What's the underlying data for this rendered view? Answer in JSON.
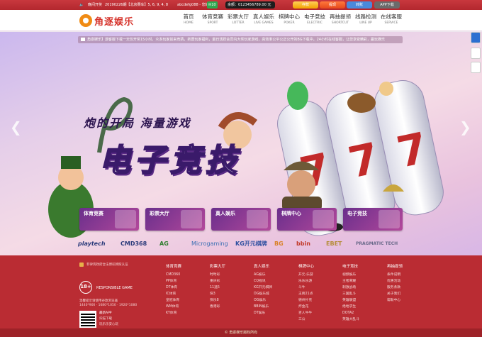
{
  "topbar": {
    "greeting": "晚间开奖",
    "notice": "20190226期【北京赛车】5, 6, 9, 4, 8",
    "username": "abcdefg088 - 您好",
    "mail_count": "10",
    "balance": "余额：0123456789.00 元",
    "deposit": "存款",
    "withdraw": "提现",
    "transfer": "转账",
    "app": "APP下载"
  },
  "nav": {
    "logo": "角逐娱乐",
    "items": [
      {
        "cn": "首页",
        "en": "HOME"
      },
      {
        "cn": "体育竞赛",
        "en": "SPORT"
      },
      {
        "cn": "彩票大厅",
        "en": "LOTTER"
      },
      {
        "cn": "真人娱乐",
        "en": "LIVE GAMES"
      },
      {
        "cn": "棋牌中心",
        "en": "POKER"
      },
      {
        "cn": "电子竞技",
        "en": "ELECTRIC"
      },
      {
        "cn": "再抽提领",
        "en": "SHORTCUT"
      },
      {
        "cn": "线路检测",
        "en": "LINE UP"
      },
      {
        "cn": "在线客服",
        "en": "SERVICE"
      }
    ]
  },
  "banner": {
    "marquee": "角逐娱乐】游客版下载一天仅开奖15小时，众多玩家前来竞猜，新晋玩家福利，最日活跃会员内大奖玩家游戏，高效率公平公正公开的BG下载中，24小时在线客服，让您享受精彩，赢玩娱乐",
    "headline": "炮的开局 海量游戏",
    "title": "电子竞技",
    "tiles": [
      "体育竞赛",
      "彩票大厅",
      "真人娱乐",
      "棋牌中心",
      "电子竞技"
    ],
    "providers": [
      "playtech",
      "CMD368",
      "AG",
      "Microgaming",
      "KG开元棋牌",
      "BG",
      "bbin",
      "EBET",
      "PRAGMATIC TECH"
    ]
  },
  "footer": {
    "tagline": "菲律宾政府合法博彩牌照认证",
    "responsible": "RESPONSIBLE GAME",
    "badge": "18+",
    "browser_note": "温馨提示请使用谷歌浏览器",
    "resolutions": "1440*900 · 1680*1050 · 1920*1080",
    "app_title": "最新APP",
    "app_scan": "扫描下载",
    "app_note": "玩乐乐安心玩",
    "columns": [
      {
        "head": "体育竞赛",
        "items": [
          "CMD360",
          "PP体育",
          "DT体育",
          "IC体育",
          "皇冠体育",
          "WM体育",
          "KY体育"
        ]
      },
      {
        "head": "彩票大厅",
        "items": [
          "时时彩",
          "重庆彩",
          "11选5",
          "快3",
          "快乐8",
          "香港彩"
        ]
      },
      {
        "head": "真人娱乐",
        "items": [
          "AG娱乐",
          "CQ视讯",
          "KG开元棋牌",
          "DG娱乐城",
          "OG娱乐",
          "BBIN娱乐",
          "DT娱乐"
        ]
      },
      {
        "head": "棋牌中心",
        "items": [
          "开元·乐游",
          "乐乐乐游",
          "斗牛",
          "王牌21点",
          "德州扑克",
          "炸金花",
          "百人牛牛",
          "三公"
        ]
      },
      {
        "head": "电子竞技",
        "items": [
          "视频娱乐",
          "王者荣耀",
          "刺激战场",
          "三国乱斗",
          "英雄联盟",
          "绝地求生",
          "DOTA2",
          "英雄大乱斗"
        ]
      },
      {
        "head": "再抽提领",
        "items": [
          "条件说明",
          "优惠活动",
          "服务条款",
          "关于我们",
          "帮助中心"
        ]
      }
    ],
    "copyright": "© 角逐娱乐版权所有"
  },
  "colors": {
    "brand_red": "#ba2c33",
    "logo_orange": "#f08b14"
  },
  "icons": [
    "speaker-icon",
    "mail-icon",
    "gift-icon",
    "card-icon",
    "phone-icon",
    "chevron-left-icon",
    "chevron-right-icon"
  ]
}
